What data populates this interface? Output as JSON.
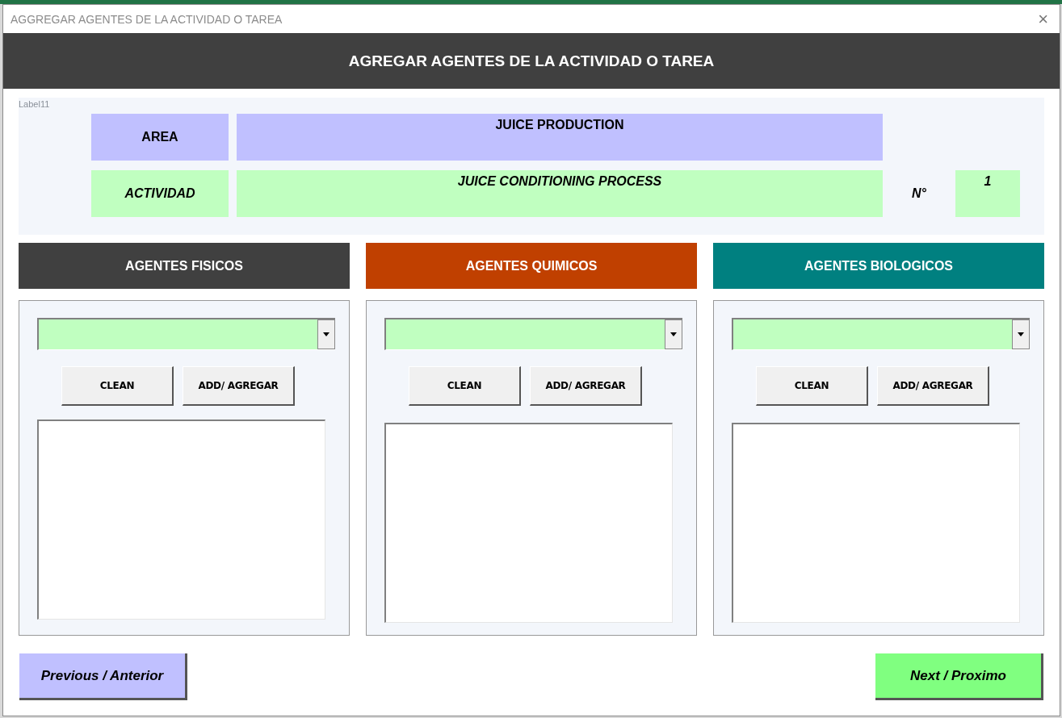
{
  "window": {
    "title": "AGGREGAR AGENTES DE LA ACTIVIDAD O TAREA",
    "close": "×"
  },
  "header": {
    "title": "AGREGAR AGENTES DE LA ACTIVIDAD O TAREA"
  },
  "info": {
    "caption": "Label11",
    "area": {
      "label": "AREA",
      "value": "JUICE PRODUCTION"
    },
    "activity": {
      "label": "ACTIVIDAD",
      "value": "JUICE CONDITIONING PROCESS"
    },
    "number": {
      "label": "N°",
      "value": "1"
    }
  },
  "agent_groups": [
    {
      "title": "AGENTES FISICOS",
      "color": "#404040",
      "buttons": [
        "CLEAN",
        "ADD/ AGREGAR"
      ]
    },
    {
      "title": "AGENTES QUIMICOS",
      "color": "#c04000",
      "buttons": [
        "CLEAN",
        "ADD/ AGREGAR"
      ]
    },
    {
      "title": "AGENTES BIOLOGICOS",
      "color": "#008080",
      "buttons": [
        "CLEAN",
        "ADD/ AGREGAR"
      ]
    }
  ],
  "navigation": [
    {
      "label": "Previous / Anterior",
      "kind": "previous"
    },
    {
      "label": "Next / Proximo",
      "kind": "next"
    }
  ]
}
